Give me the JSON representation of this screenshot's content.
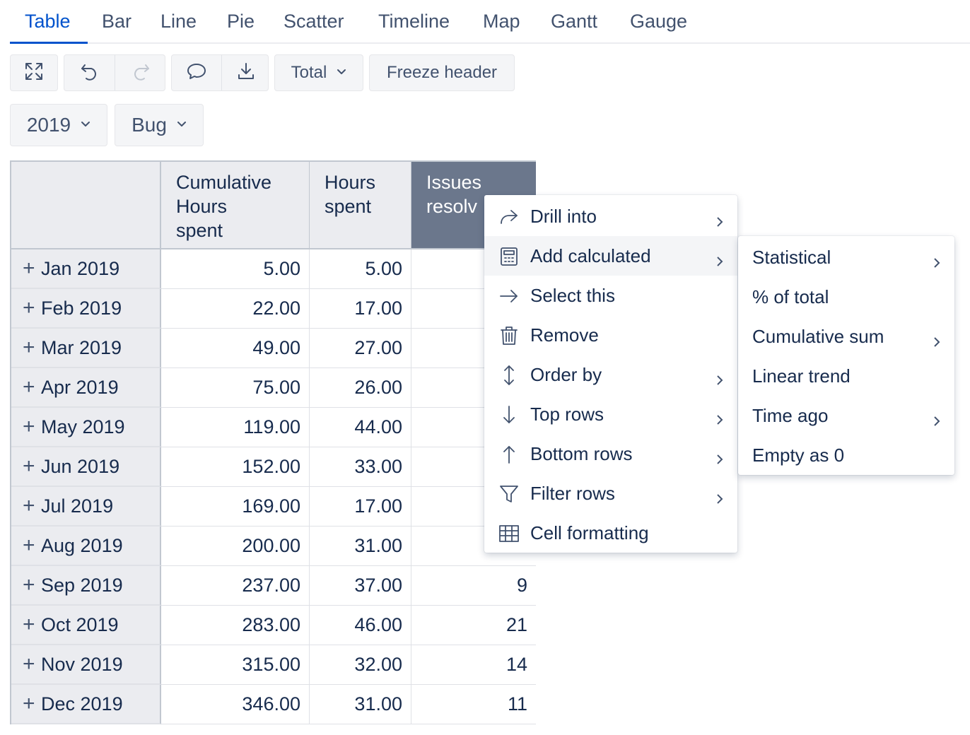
{
  "tabs": [
    "Table",
    "Bar",
    "Line",
    "Pie",
    "Scatter",
    "Timeline",
    "Map",
    "Gantt",
    "Gauge"
  ],
  "toolbar": {
    "total_label": "Total",
    "freeze_label": "Freeze header"
  },
  "filters": {
    "year": "2019",
    "issue_type": "Bug"
  },
  "table": {
    "headers": [
      "Cumulative Hours spent",
      "Hours spent",
      "Issues resolved"
    ],
    "header_lines": [
      [
        "Cumulative",
        "Hours",
        "spent"
      ],
      [
        "Hours",
        "spent"
      ],
      [
        "Issues",
        "resolv"
      ]
    ],
    "rows": [
      {
        "label": "Jan 2019",
        "cum": "5.00",
        "hours": "5.00",
        "issues": ""
      },
      {
        "label": "Feb 2019",
        "cum": "22.00",
        "hours": "17.00",
        "issues": ""
      },
      {
        "label": "Mar 2019",
        "cum": "49.00",
        "hours": "27.00",
        "issues": ""
      },
      {
        "label": "Apr 2019",
        "cum": "75.00",
        "hours": "26.00",
        "issues": ""
      },
      {
        "label": "May 2019",
        "cum": "119.00",
        "hours": "44.00",
        "issues": ""
      },
      {
        "label": "Jun 2019",
        "cum": "152.00",
        "hours": "33.00",
        "issues": ""
      },
      {
        "label": "Jul 2019",
        "cum": "169.00",
        "hours": "17.00",
        "issues": ""
      },
      {
        "label": "Aug 2019",
        "cum": "200.00",
        "hours": "31.00",
        "issues": ""
      },
      {
        "label": "Sep 2019",
        "cum": "237.00",
        "hours": "37.00",
        "issues": "9"
      },
      {
        "label": "Oct 2019",
        "cum": "283.00",
        "hours": "46.00",
        "issues": "21"
      },
      {
        "label": "Nov 2019",
        "cum": "315.00",
        "hours": "32.00",
        "issues": "14"
      },
      {
        "label": "Dec 2019",
        "cum": "346.00",
        "hours": "31.00",
        "issues": "11"
      }
    ]
  },
  "context_menu": {
    "items": [
      {
        "label": "Drill into",
        "icon": "share-arrow-icon",
        "submenu": true
      },
      {
        "label": "Add calculated",
        "icon": "calculator-icon",
        "submenu": true,
        "highlighted": true
      },
      {
        "label": "Select this",
        "icon": "arrow-right-icon",
        "submenu": false
      },
      {
        "label": "Remove",
        "icon": "trash-icon",
        "submenu": false
      },
      {
        "label": "Order by",
        "icon": "sort-vertical-icon",
        "submenu": true
      },
      {
        "label": "Top rows",
        "icon": "arrow-down-icon",
        "submenu": true
      },
      {
        "label": "Bottom rows",
        "icon": "arrow-up-icon",
        "submenu": true
      },
      {
        "label": "Filter rows",
        "icon": "filter-icon",
        "submenu": true
      },
      {
        "label": "Cell formatting",
        "icon": "grid-icon",
        "submenu": false
      }
    ]
  },
  "submenu": {
    "items": [
      {
        "label": "Statistical",
        "submenu": true
      },
      {
        "label": "% of total",
        "submenu": false
      },
      {
        "label": "Cumulative sum",
        "submenu": true
      },
      {
        "label": "Linear trend",
        "submenu": false
      },
      {
        "label": "Time ago",
        "submenu": true
      },
      {
        "label": "Empty as 0",
        "submenu": false
      }
    ]
  },
  "colors": {
    "accent": "#0052cc",
    "selected_header": "#6b778c",
    "header_bg": "#ebecf0",
    "text": "#172b4d"
  }
}
